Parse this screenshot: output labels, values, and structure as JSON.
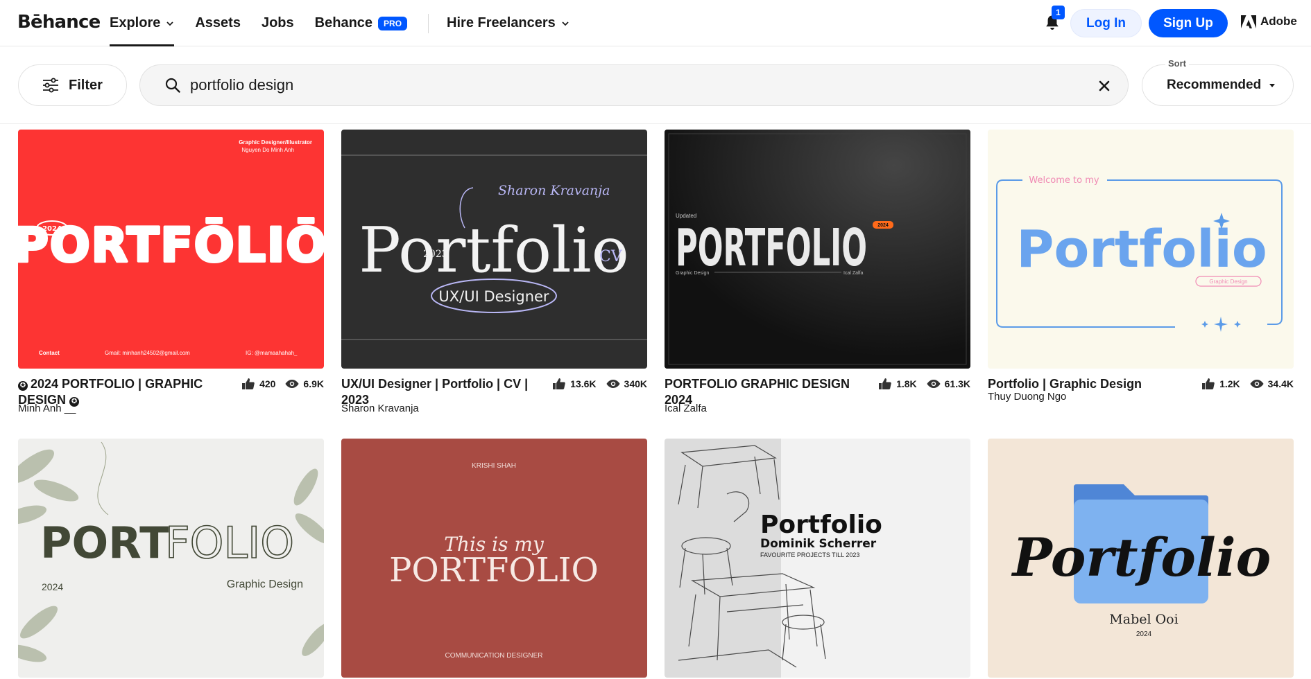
{
  "header": {
    "logo": "Bēhance",
    "nav": [
      {
        "label": "Explore",
        "dropdown": true,
        "active": true
      },
      {
        "label": "Assets"
      },
      {
        "label": "Jobs"
      },
      {
        "label": "Behance",
        "badge": "PRO"
      },
      {
        "label": "Hire Freelancers",
        "dropdown": true
      }
    ],
    "notifications_count": "1",
    "login_label": "Log In",
    "signup_label": "Sign Up",
    "adobe_label": "Adobe",
    "brand_color": "#0057ff"
  },
  "search": {
    "filter_label": "Filter",
    "query": "portfolio design",
    "sort_caption": "Sort",
    "sort_value": "Recommended"
  },
  "projects": [
    {
      "title": "2024 PORTFOLIO | GRAPHIC DESIGN",
      "owner": "Minh Anh __",
      "likes": "420",
      "views": "6.9K",
      "featured": true,
      "thumb": {
        "tagline": "Graphic Designer/Illustrator",
        "name": "Nguyen Do Minh Anh",
        "year": "2024",
        "word": "PORTFŌLIŌ",
        "contact": "Contact",
        "email": "Gmail: minhanh24502@gmail.com",
        "ig": "IG: @mamaahahah_"
      }
    },
    {
      "title": "UX/UI Designer | Portfolio | CV | 2023",
      "owner": "Sharon Kravanja",
      "likes": "13.6K",
      "views": "340K",
      "thumb": {
        "signature": "Sharon Kravanja",
        "word": "Portfolio",
        "year": "2023",
        "cv": "CV",
        "role": "UX/UI Designer"
      }
    },
    {
      "title": "PORTFOLIO GRAPHIC DESIGN 2024",
      "owner": "Ical Zalfa",
      "likes": "1.8K",
      "views": "61.3K",
      "thumb": {
        "updated": "Updated",
        "word": "PORTFOLIO",
        "year": "2024",
        "left": "Graphic Design",
        "right": "Ical Zalfa"
      }
    },
    {
      "title": "Portfolio | Graphic Design",
      "owner": "Thuy Duong Ngo",
      "likes": "1.2K",
      "views": "34.4K",
      "thumb": {
        "welcome": "Welcome to my",
        "word": "Portfolio",
        "tag": "Graphic Design"
      }
    },
    {
      "title": "",
      "owner": "",
      "thumb": {
        "word_bold": "PORT",
        "word_light": "FOLIO",
        "year": "2024",
        "sub": "Graphic Design"
      }
    },
    {
      "title": "",
      "owner": "",
      "thumb": {
        "name": "KRISHI SHAH",
        "script": "This is my",
        "word": "PORTFOLIO",
        "role": "COMMUNICATION DESIGNER"
      }
    },
    {
      "title": "",
      "owner": "",
      "thumb": {
        "word": "Portfolio",
        "name": "Dominik Scherrer",
        "sub": "FAVOURITE PROJECTS TILL 2023"
      }
    },
    {
      "title": "",
      "owner": "",
      "thumb": {
        "word": "Portfolio",
        "name": "Mabel Ooi",
        "year": "2024"
      }
    }
  ]
}
